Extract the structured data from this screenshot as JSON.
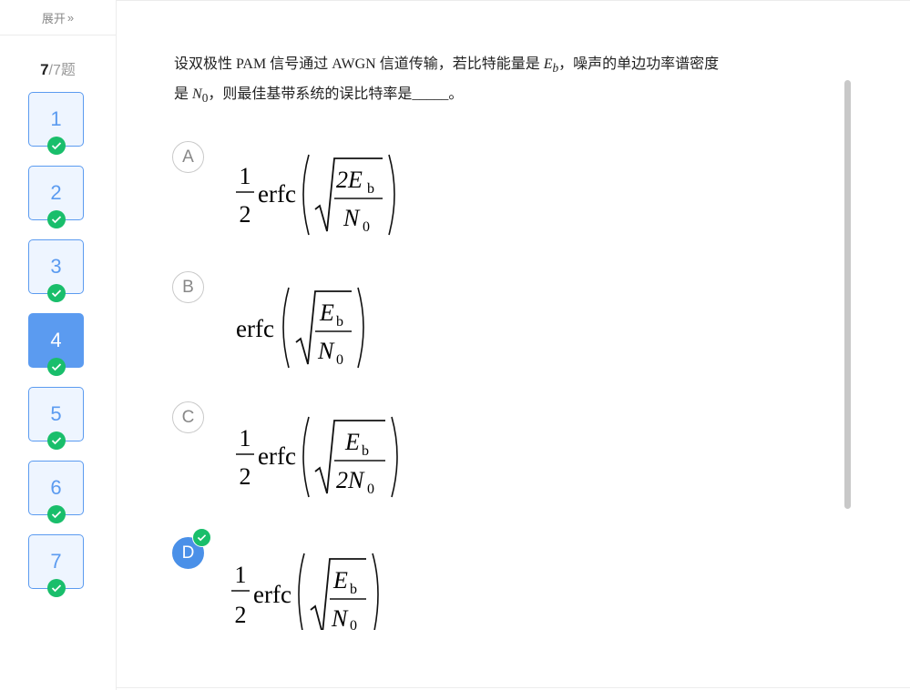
{
  "sidebar": {
    "expand_label": "展开",
    "expand_icon": "»",
    "current": "7",
    "total_suffix": "/7题",
    "questions": [
      {
        "number": "1",
        "answered": true,
        "active": false
      },
      {
        "number": "2",
        "answered": true,
        "active": false
      },
      {
        "number": "3",
        "answered": true,
        "active": false
      },
      {
        "number": "4",
        "answered": true,
        "active": true
      },
      {
        "number": "5",
        "answered": true,
        "active": false
      },
      {
        "number": "6",
        "answered": true,
        "active": false
      },
      {
        "number": "7",
        "answered": true,
        "active": false
      }
    ]
  },
  "question": {
    "text_1": "设双极性 PAM 信号通过 AWGN 信道传输，若比特能量是 ",
    "eb": "E",
    "eb_sub": "b",
    "text_2": "，噪声的单边功率谱密度是 ",
    "n0": "N",
    "n0_sub": "0",
    "text_3": "，则最佳基带系统的误比特率是_____。"
  },
  "options": [
    {
      "letter": "A",
      "selected": false,
      "coef_num": "1",
      "coef_den": "2",
      "func": "erfc",
      "num": "2E",
      "num_sub": "b",
      "den": "N",
      "den_sub": "0"
    },
    {
      "letter": "B",
      "selected": false,
      "coef_num": "",
      "coef_den": "",
      "func": "erfc",
      "num": "E",
      "num_sub": "b",
      "den": "N",
      "den_sub": "0"
    },
    {
      "letter": "C",
      "selected": false,
      "coef_num": "1",
      "coef_den": "2",
      "func": "erfc",
      "num": "E",
      "num_sub": "b",
      "den": "2N",
      "den_sub": "0"
    },
    {
      "letter": "D",
      "selected": true,
      "coef_num": "1",
      "coef_den": "2",
      "func": "erfc",
      "num": "E",
      "num_sub": "b",
      "den": "N",
      "den_sub": "0"
    }
  ],
  "colors": {
    "accent": "#5b9bf0",
    "selected_option": "#4a90e8",
    "check_green": "#19be6b"
  }
}
